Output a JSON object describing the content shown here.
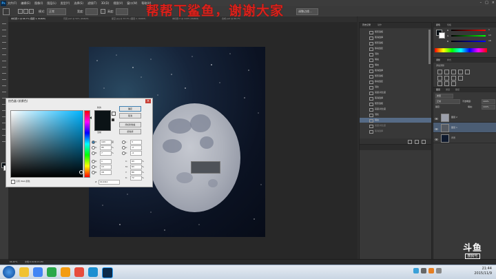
{
  "app": {
    "name": "Ps"
  },
  "menu": [
    "文件(F)",
    "编辑(E)",
    "图像(I)",
    "图层(L)",
    "类型(Y)",
    "选择(S)",
    "滤镜(T)",
    "3D(D)",
    "视图(V)",
    "窗口(W)",
    "帮助(H)"
  ],
  "window_controls": [
    "–",
    "□",
    "×"
  ],
  "options_bar": {
    "mode_label": "模式:",
    "mode_value": "正常",
    "width_label": "宽度:",
    "height_label": "高度:",
    "adjust_edge": "调整边缘..."
  },
  "banner": "帮帮下鲨鱼，谢谢大家",
  "tabs": [
    "未标题-1 @ 66.7% (图层 1, RGB/8)",
    "月亮.psd @ 50% (RGB/8)",
    "星空.jpg @ 33.3% (图层 2, RGB/8)",
    "未标题-2 @ 100% (RGB/8)",
    "合成.psd @ 66.7%"
  ],
  "color_picker": {
    "title": "拾色器 (前景色)",
    "new_label": "新的",
    "current_label": "当前",
    "buttons": [
      "确定",
      "取消",
      "添加到色板",
      "颜色库"
    ],
    "hsb": [
      {
        "k": "H:",
        "v": "193",
        "u": "度"
      },
      {
        "k": "S:",
        "v": "95",
        "u": "%"
      },
      {
        "k": "B:",
        "v": "7",
        "u": "%"
      }
    ],
    "rgb": [
      {
        "k": "R:",
        "v": "1"
      },
      {
        "k": "G:",
        "v": "13"
      },
      {
        "k": "B:",
        "v": "18"
      }
    ],
    "lab": [
      {
        "k": "L:",
        "v": "3"
      },
      {
        "k": "a:",
        "v": "-2"
      },
      {
        "k": "b:",
        "v": "-4"
      }
    ],
    "cmyk": [
      {
        "k": "C:",
        "v": "93",
        "u": "%"
      },
      {
        "k": "M:",
        "v": "83",
        "u": "%"
      },
      {
        "k": "Y:",
        "v": "80",
        "u": "%"
      },
      {
        "k": "K:",
        "v": "72",
        "u": "%"
      }
    ],
    "hex_label": "#",
    "hex": "010d12",
    "web_only": "只有 Web 颜色"
  },
  "history": {
    "tabs": [
      "历史记录",
      "动作"
    ],
    "items": [
      {
        "icon": "history-step-icon",
        "label": "矩形选框"
      },
      {
        "icon": "history-step-icon",
        "label": "取消选择"
      },
      {
        "icon": "history-step-icon",
        "label": "矩形选框"
      },
      {
        "icon": "history-step-icon",
        "label": "移动选区"
      },
      {
        "icon": "history-step-icon",
        "label": "羽化"
      },
      {
        "icon": "history-step-icon",
        "label": "填充"
      },
      {
        "icon": "history-step-icon",
        "label": "填充"
      },
      {
        "icon": "history-step-icon",
        "label": "取消选择"
      },
      {
        "icon": "history-step-icon",
        "label": "矩形选框"
      },
      {
        "icon": "history-step-icon",
        "label": "移动选区"
      },
      {
        "icon": "history-step-icon",
        "label": "羽化"
      },
      {
        "icon": "history-step-icon",
        "label": "亮度/对比度"
      },
      {
        "icon": "history-step-icon",
        "label": "取消选择"
      },
      {
        "icon": "history-step-icon",
        "label": "矩形选框"
      },
      {
        "icon": "history-step-icon",
        "label": "亮度/对比度"
      },
      {
        "icon": "history-step-icon",
        "label": "羽化"
      },
      {
        "icon": "history-step-icon",
        "label": "填充"
      },
      {
        "icon": "history-step-icon",
        "label": "亮度/对比度"
      },
      {
        "icon": "history-step-icon",
        "label": "取消选择"
      }
    ]
  },
  "color_panel": {
    "tabs": [
      "颜色",
      "色板"
    ],
    "r_label": "R",
    "g_label": "G",
    "b_label": "B",
    "r_value": "1",
    "g_value": "13",
    "b_value": "18"
  },
  "adjustments": {
    "tabs": [
      "调整",
      "样式"
    ],
    "title": "添加调整"
  },
  "layers": {
    "tabs": [
      "图层",
      "通道",
      "路径"
    ],
    "kind_label": "类型",
    "blend_mode": "正常",
    "opacity_label": "不透明度:",
    "opacity_value": "100%",
    "lock_label": "锁定:",
    "fill_label": "填充:",
    "fill_value": "100%",
    "items": [
      {
        "name": "图层 2",
        "selected": false
      },
      {
        "name": "图层 1",
        "selected": true
      },
      {
        "name": "背景",
        "selected": false
      }
    ]
  },
  "status": {
    "zoom": "66.67%",
    "doc": "文档:6.61M/13.2M"
  },
  "watermark": {
    "big": "斗鱼",
    "small": "搜狗号"
  },
  "taskbar": {
    "time": "21:44",
    "date": "2015/11/9"
  },
  "colors": {
    "banner": "#d8221c",
    "selection": "#566b86",
    "picked": "#010d12"
  }
}
